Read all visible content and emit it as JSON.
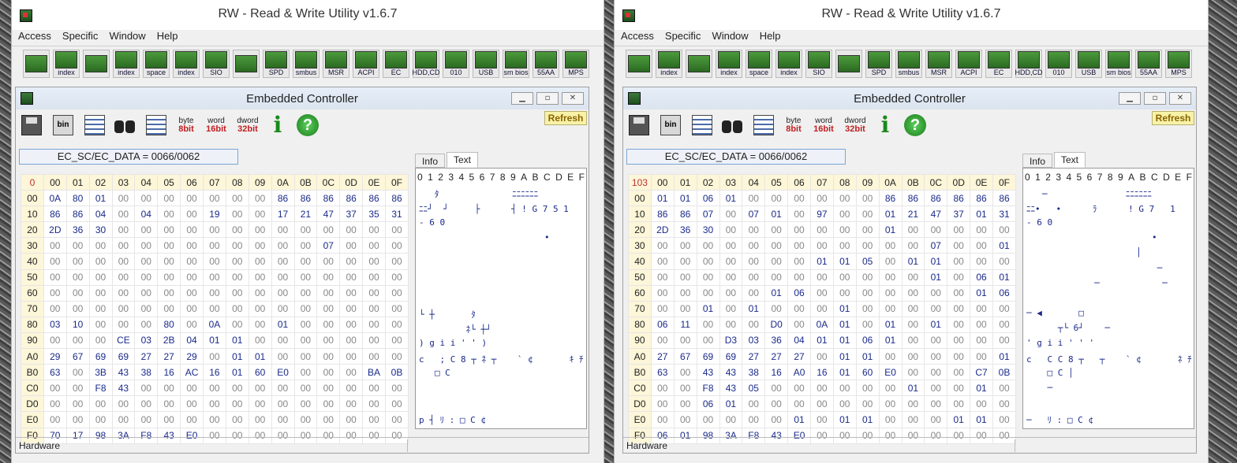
{
  "windows": [
    {
      "title": "RW - Read & Write Utility v1.6.7",
      "menu": [
        "Access",
        "Specific",
        "Window",
        "Help"
      ],
      "toolbar_buttons": [
        {
          "icon": "memory-icon",
          "label": ""
        },
        {
          "icon": "index-icon",
          "label": "index"
        },
        {
          "icon": "memory-icon",
          "label": ""
        },
        {
          "icon": "index-icon",
          "label": "index"
        },
        {
          "icon": "io-space-icon",
          "label": "space"
        },
        {
          "icon": "io-index-icon",
          "label": "index"
        },
        {
          "icon": "sio-icon",
          "label": "SIO"
        },
        {
          "icon": "oscilloscope-icon",
          "label": ""
        },
        {
          "icon": "spd-icon",
          "label": "SPD"
        },
        {
          "icon": "smbus-icon",
          "label": "smbus"
        },
        {
          "icon": "msr-icon",
          "label": "MSR"
        },
        {
          "icon": "acpi-icon",
          "label": "ACPI"
        },
        {
          "icon": "ec-icon",
          "label": "EC"
        },
        {
          "icon": "hdd-cd-icon",
          "label": "HDD,CD"
        },
        {
          "icon": "disk-icon",
          "label": "010"
        },
        {
          "icon": "usb-icon",
          "label": "USB"
        },
        {
          "icon": "smbios-icon",
          "label": "sm bios"
        },
        {
          "icon": "55aa-icon",
          "label": "55AA"
        },
        {
          "icon": "mps-icon",
          "label": "MPS"
        }
      ],
      "ec": {
        "title": "Embedded Controller",
        "refresh": "Refresh",
        "address": "EC_SC/EC_DATA = 0066/0062",
        "tools": [
          {
            "label": "",
            "sub": ""
          },
          {
            "label": "bin",
            "sub": ""
          },
          {
            "label": "",
            "sub": ""
          },
          {
            "label": "",
            "sub": ""
          },
          {
            "label": "",
            "sub": ""
          },
          {
            "label": "byte",
            "sub": "8bit"
          },
          {
            "label": "word",
            "sub": "16bit"
          },
          {
            "label": "dword",
            "sub": "32bit"
          },
          {
            "label": "i",
            "sub": ""
          },
          {
            "label": "?",
            "sub": ""
          }
        ],
        "tabs": [
          "Info",
          "Text"
        ],
        "active_tab": "Text",
        "corner": "0",
        "col_headers": [
          "00",
          "01",
          "02",
          "03",
          "04",
          "05",
          "06",
          "07",
          "08",
          "09",
          "0A",
          "0B",
          "0C",
          "0D",
          "0E",
          "0F"
        ],
        "row_headers": [
          "00",
          "10",
          "20",
          "30",
          "40",
          "50",
          "60",
          "70",
          "80",
          "90",
          "A0",
          "B0",
          "C0",
          "D0",
          "E0",
          "F0"
        ],
        "rows": [
          [
            "0A",
            "80",
            "01",
            "00",
            "00",
            "00",
            "00",
            "00",
            "00",
            "00",
            "86",
            "86",
            "86",
            "86",
            "86",
            "86"
          ],
          [
            "86",
            "86",
            "04",
            "00",
            "04",
            "00",
            "00",
            "19",
            "00",
            "00",
            "17",
            "21",
            "47",
            "37",
            "35",
            "31"
          ],
          [
            "2D",
            "36",
            "30",
            "00",
            "00",
            "00",
            "00",
            "00",
            "00",
            "00",
            "00",
            "00",
            "00",
            "00",
            "00",
            "00"
          ],
          [
            "00",
            "00",
            "00",
            "00",
            "00",
            "00",
            "00",
            "00",
            "00",
            "00",
            "00",
            "00",
            "07",
            "00",
            "00",
            "00"
          ],
          [
            "00",
            "00",
            "00",
            "00",
            "00",
            "00",
            "00",
            "00",
            "00",
            "00",
            "00",
            "00",
            "00",
            "00",
            "00",
            "00"
          ],
          [
            "00",
            "00",
            "00",
            "00",
            "00",
            "00",
            "00",
            "00",
            "00",
            "00",
            "00",
            "00",
            "00",
            "00",
            "00",
            "00"
          ],
          [
            "00",
            "00",
            "00",
            "00",
            "00",
            "00",
            "00",
            "00",
            "00",
            "00",
            "00",
            "00",
            "00",
            "00",
            "00",
            "00"
          ],
          [
            "00",
            "00",
            "00",
            "00",
            "00",
            "00",
            "00",
            "00",
            "00",
            "00",
            "00",
            "00",
            "00",
            "00",
            "00",
            "00"
          ],
          [
            "03",
            "10",
            "00",
            "00",
            "00",
            "80",
            "00",
            "0A",
            "00",
            "00",
            "01",
            "00",
            "00",
            "00",
            "00",
            "00"
          ],
          [
            "00",
            "00",
            "00",
            "CE",
            "03",
            "2B",
            "04",
            "01",
            "01",
            "00",
            "00",
            "00",
            "00",
            "00",
            "00",
            "00"
          ],
          [
            "29",
            "67",
            "69",
            "69",
            "27",
            "27",
            "29",
            "00",
            "01",
            "01",
            "00",
            "00",
            "00",
            "00",
            "00",
            "00"
          ],
          [
            "63",
            "00",
            "3B",
            "43",
            "38",
            "16",
            "AC",
            "16",
            "01",
            "60",
            "E0",
            "00",
            "00",
            "00",
            "BA",
            "0B"
          ],
          [
            "00",
            "00",
            "F8",
            "43",
            "00",
            "00",
            "00",
            "00",
            "00",
            "00",
            "00",
            "00",
            "00",
            "00",
            "00",
            "00"
          ],
          [
            "00",
            "00",
            "00",
            "00",
            "00",
            "00",
            "00",
            "00",
            "00",
            "00",
            "00",
            "00",
            "00",
            "00",
            "00",
            "00"
          ],
          [
            "00",
            "00",
            "00",
            "00",
            "00",
            "00",
            "00",
            "00",
            "00",
            "00",
            "00",
            "00",
            "00",
            "00",
            "00",
            "00"
          ],
          [
            "70",
            "17",
            "98",
            "3A",
            "F8",
            "43",
            "E0",
            "00",
            "00",
            "00",
            "00",
            "00",
            "00",
            "00",
            "00",
            "00"
          ]
        ],
        "text_header": [
          "0",
          "1",
          "2",
          "3",
          "4",
          "5",
          "6",
          "7",
          "8",
          "9",
          "A",
          "B",
          "C",
          "D",
          "E",
          "F"
        ],
        "text_rows": [
          "   ﾀ              ﾆﾆﾆﾆﾆﾆ",
          "ﾆﾆ┘  ┘     ├      ┤ ! G 7 5 1",
          "- 6 0",
          "                        •",
          "",
          "",
          "",
          "",
          "└ ┼       ﾀ",
          "         ﾈ└ ┼┘",
          ") g i i ' ' )",
          "c   ; C 8 ┬ ﾈ ┬    ` ¢       ｷ ﾁ",
          "   □ C",
          "",
          "",
          "p ┤ ﾘ : □ C ¢"
        ],
        "status": "Hardware"
      }
    },
    {
      "title": "RW - Read & Write Utility v1.6.7",
      "menu": [
        "Access",
        "Specific",
        "Window",
        "Help"
      ],
      "toolbar_buttons": [
        {
          "icon": "memory-icon",
          "label": ""
        },
        {
          "icon": "index-icon",
          "label": "index"
        },
        {
          "icon": "memory-icon",
          "label": ""
        },
        {
          "icon": "index-icon",
          "label": "index"
        },
        {
          "icon": "io-space-icon",
          "label": "space"
        },
        {
          "icon": "io-index-icon",
          "label": "index"
        },
        {
          "icon": "sio-icon",
          "label": "SIO"
        },
        {
          "icon": "oscilloscope-icon",
          "label": ""
        },
        {
          "icon": "spd-icon",
          "label": "SPD"
        },
        {
          "icon": "smbus-icon",
          "label": "smbus"
        },
        {
          "icon": "msr-icon",
          "label": "MSR"
        },
        {
          "icon": "acpi-icon",
          "label": "ACPI"
        },
        {
          "icon": "ec-icon",
          "label": "EC"
        },
        {
          "icon": "hdd-cd-icon",
          "label": "HDD,CD"
        },
        {
          "icon": "disk-icon",
          "label": "010"
        },
        {
          "icon": "usb-icon",
          "label": "USB"
        },
        {
          "icon": "smbios-icon",
          "label": "sm bios"
        },
        {
          "icon": "55aa-icon",
          "label": "55AA"
        },
        {
          "icon": "mps-icon",
          "label": "MPS"
        }
      ],
      "ec": {
        "title": "Embedded Controller",
        "refresh": "Refresh",
        "address": "EC_SC/EC_DATA = 0066/0062",
        "tools": [
          {
            "label": "",
            "sub": ""
          },
          {
            "label": "bin",
            "sub": ""
          },
          {
            "label": "",
            "sub": ""
          },
          {
            "label": "",
            "sub": ""
          },
          {
            "label": "",
            "sub": ""
          },
          {
            "label": "byte",
            "sub": "8bit"
          },
          {
            "label": "word",
            "sub": "16bit"
          },
          {
            "label": "dword",
            "sub": "32bit"
          },
          {
            "label": "i",
            "sub": ""
          },
          {
            "label": "?",
            "sub": ""
          }
        ],
        "tabs": [
          "Info",
          "Text"
        ],
        "active_tab": "Text",
        "corner": "103",
        "col_headers": [
          "00",
          "01",
          "02",
          "03",
          "04",
          "05",
          "06",
          "07",
          "08",
          "09",
          "0A",
          "0B",
          "0C",
          "0D",
          "0E",
          "0F"
        ],
        "row_headers": [
          "00",
          "10",
          "20",
          "30",
          "40",
          "50",
          "60",
          "70",
          "80",
          "90",
          "A0",
          "B0",
          "C0",
          "D0",
          "E0",
          "F0"
        ],
        "rows": [
          [
            "01",
            "01",
            "06",
            "01",
            "00",
            "00",
            "00",
            "00",
            "00",
            "00",
            "86",
            "86",
            "86",
            "86",
            "86",
            "86"
          ],
          [
            "86",
            "86",
            "07",
            "00",
            "07",
            "01",
            "00",
            "97",
            "00",
            "00",
            "01",
            "21",
            "47",
            "37",
            "01",
            "31"
          ],
          [
            "2D",
            "36",
            "30",
            "00",
            "00",
            "00",
            "00",
            "00",
            "00",
            "00",
            "01",
            "00",
            "00",
            "00",
            "00",
            "00"
          ],
          [
            "00",
            "00",
            "00",
            "00",
            "00",
            "00",
            "00",
            "00",
            "00",
            "00",
            "00",
            "00",
            "07",
            "00",
            "00",
            "01"
          ],
          [
            "00",
            "00",
            "00",
            "00",
            "00",
            "00",
            "00",
            "01",
            "01",
            "05",
            "00",
            "01",
            "01",
            "00",
            "00",
            "00"
          ],
          [
            "00",
            "00",
            "00",
            "00",
            "00",
            "00",
            "00",
            "00",
            "00",
            "00",
            "00",
            "00",
            "01",
            "00",
            "06",
            "01"
          ],
          [
            "00",
            "00",
            "00",
            "00",
            "00",
            "01",
            "06",
            "00",
            "00",
            "00",
            "00",
            "00",
            "00",
            "00",
            "01",
            "06"
          ],
          [
            "00",
            "00",
            "01",
            "00",
            "01",
            "00",
            "00",
            "00",
            "01",
            "00",
            "00",
            "00",
            "00",
            "00",
            "00",
            "00"
          ],
          [
            "06",
            "11",
            "00",
            "00",
            "00",
            "D0",
            "00",
            "0A",
            "01",
            "00",
            "01",
            "00",
            "01",
            "00",
            "00",
            "00"
          ],
          [
            "00",
            "00",
            "00",
            "D3",
            "03",
            "36",
            "04",
            "01",
            "01",
            "06",
            "01",
            "00",
            "00",
            "00",
            "00",
            "00"
          ],
          [
            "27",
            "67",
            "69",
            "69",
            "27",
            "27",
            "27",
            "00",
            "01",
            "01",
            "00",
            "00",
            "00",
            "00",
            "00",
            "01"
          ],
          [
            "63",
            "00",
            "43",
            "43",
            "38",
            "16",
            "A0",
            "16",
            "01",
            "60",
            "E0",
            "00",
            "00",
            "00",
            "C7",
            "0B"
          ],
          [
            "00",
            "00",
            "F8",
            "43",
            "05",
            "00",
            "00",
            "00",
            "00",
            "00",
            "00",
            "01",
            "00",
            "00",
            "01",
            "00"
          ],
          [
            "00",
            "00",
            "06",
            "01",
            "00",
            "00",
            "00",
            "00",
            "00",
            "00",
            "00",
            "00",
            "00",
            "00",
            "00",
            "00"
          ],
          [
            "00",
            "00",
            "00",
            "00",
            "00",
            "00",
            "01",
            "00",
            "01",
            "01",
            "00",
            "00",
            "00",
            "01",
            "01",
            "00"
          ],
          [
            "06",
            "01",
            "98",
            "3A",
            "F8",
            "43",
            "E0",
            "00",
            "00",
            "00",
            "00",
            "00",
            "00",
            "00",
            "00",
            "00"
          ]
        ],
        "text_header": [
          "0",
          "1",
          "2",
          "3",
          "4",
          "5",
          "6",
          "7",
          "8",
          "9",
          "A",
          "B",
          "C",
          "D",
          "E",
          "F"
        ],
        "text_rows": [
          "   ─               ﾆﾆﾆﾆﾆﾆ",
          "ﾆﾆ•   •      ﾗ      ! G 7   1",
          "- 6 0",
          "                        •",
          "                     │",
          "                         ─",
          "             ─            ─",
          "",
          "─ ◀       □",
          "      ┬└ 6┘    ─",
          "' g i i ' ' '",
          "c   C C 8 ┬   ┬    ` ¢       ﾈ ﾁ",
          "    □ C │",
          "    ─",
          "",
          "─   ﾘ : □ C ¢"
        ],
        "status": "Hardware"
      }
    }
  ]
}
